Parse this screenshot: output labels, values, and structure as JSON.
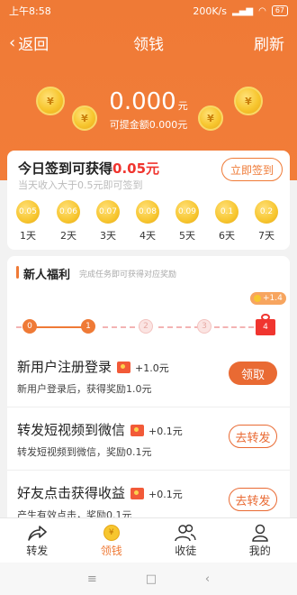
{
  "status": {
    "time": "上午8:58",
    "speed": "200K/s",
    "battery": "67"
  },
  "header": {
    "back": "返回",
    "title": "领钱",
    "refresh": "刷新"
  },
  "balance": {
    "amount": "0.000",
    "unit": "元",
    "withdrawable": "可提金额0.000元",
    "coin_symbol": "¥"
  },
  "signin": {
    "title_prefix": "今日签到可获得",
    "title_amount": "0.05元",
    "subtitle": "当天收入大于0.5元即可签到",
    "button": "立即签到",
    "days": [
      {
        "value": "0.05",
        "label": "1天"
      },
      {
        "value": "0.06",
        "label": "2天"
      },
      {
        "value": "0.07",
        "label": "3天"
      },
      {
        "value": "0.08",
        "label": "4天"
      },
      {
        "value": "0.09",
        "label": "5天"
      },
      {
        "value": "0.1",
        "label": "6天"
      },
      {
        "value": "0.2",
        "label": "7天"
      }
    ]
  },
  "newbie": {
    "title": "新人福利",
    "subtitle": "完成任务即可获得对应奖励",
    "bubble": "+1.4",
    "steps": [
      "0",
      "1",
      "2",
      "3",
      "4"
    ],
    "progress_completed_steps": 1,
    "tasks": [
      {
        "name": "新用户注册登录",
        "reward": "+1.0元",
        "desc": "新用户登录后，获得奖励1.0元",
        "button": "领取"
      },
      {
        "name": "转发短视频到微信",
        "reward": "+0.1元",
        "desc": "转发短视频到微信，奖励0.1元",
        "button": "去转发"
      },
      {
        "name": "好友点击获得收益",
        "reward": "+0.1元",
        "desc": "产生有效点击，奖励0.1元",
        "button": "去转发"
      }
    ]
  },
  "tabs": [
    {
      "label": "转发",
      "icon": "share-icon"
    },
    {
      "label": "领钱",
      "icon": "coin-icon",
      "active": true
    },
    {
      "label": "收徒",
      "icon": "apprentice-icon"
    },
    {
      "label": "我的",
      "icon": "profile-icon"
    }
  ],
  "colors": {
    "accent": "#ef7a36",
    "amount_red": "#f0352f",
    "coin": "#f7c62f"
  }
}
